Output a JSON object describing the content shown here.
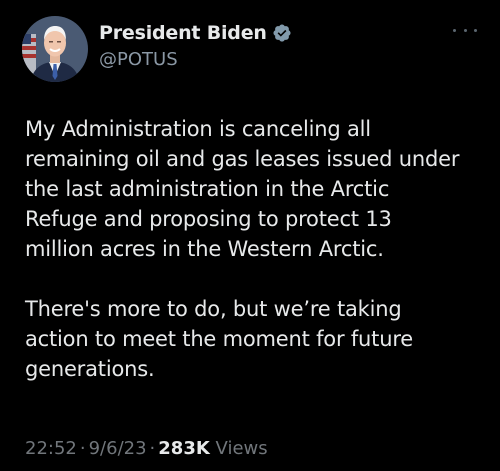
{
  "author": {
    "display_name": "President Biden",
    "handle": "@POTUS",
    "verified_icon": "verified-badge-icon",
    "avatar_icon": "profile-photo"
  },
  "tweet": {
    "paragraphs": [
      "My Administration is canceling all\nremaining oil and gas leases issued under\nthe last administration in the Arctic\nRefuge and proposing to protect 13\nmillion acres in the Western Arctic.",
      "There's more to do, but we’re taking\naction to meet the moment for future\ngenerations."
    ]
  },
  "meta": {
    "time": "22:52",
    "separator": "·",
    "date": "9/6/23",
    "views_count": "283K",
    "views_label": "Views"
  },
  "menu": {
    "icon": "more-options-icon"
  },
  "colors": {
    "background": "#000000",
    "text_primary": "#e7e9ea",
    "text_secondary": "#71767b",
    "verified_badge": "#829aab"
  }
}
